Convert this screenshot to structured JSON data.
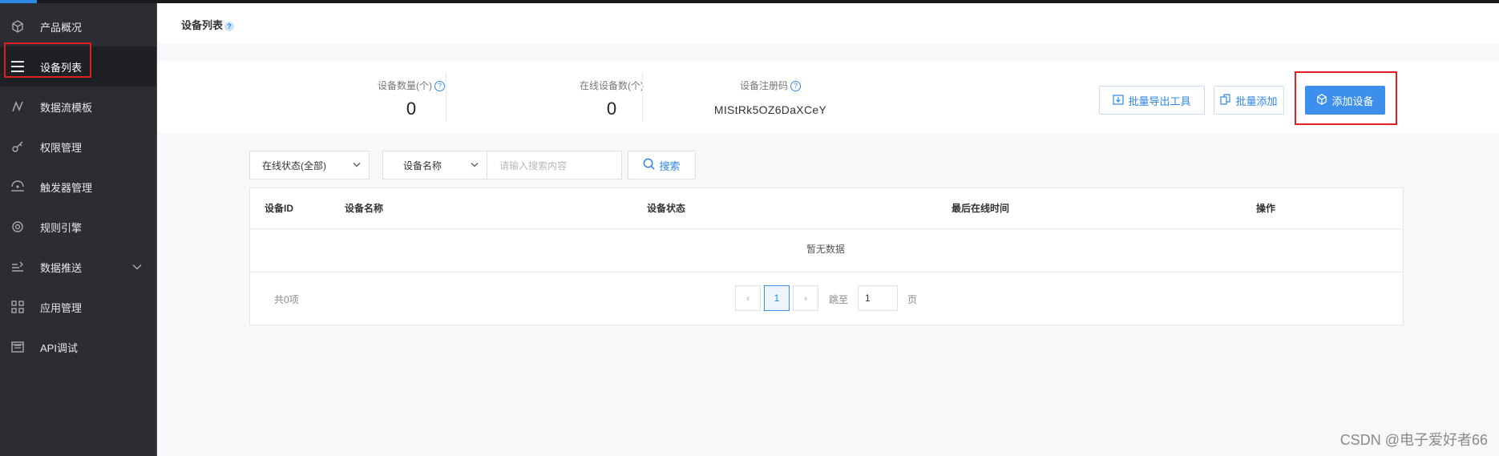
{
  "sidebar": {
    "items": [
      {
        "label": "产品概况",
        "icon": "cube-icon"
      },
      {
        "label": "设备列表",
        "icon": "list-icon",
        "active": true
      },
      {
        "label": "数据流模板",
        "icon": "dataflow-icon"
      },
      {
        "label": "权限管理",
        "icon": "key-icon"
      },
      {
        "label": "触发器管理",
        "icon": "trigger-icon"
      },
      {
        "label": "规则引擎",
        "icon": "rule-icon"
      },
      {
        "label": "数据推送",
        "icon": "push-icon",
        "expandable": true
      },
      {
        "label": "应用管理",
        "icon": "grid-icon"
      },
      {
        "label": "API调试",
        "icon": "api-icon"
      }
    ]
  },
  "header": {
    "title": "设备列表",
    "help": "?"
  },
  "stats": {
    "device_count_label": "设备数量(个)",
    "device_count": "0",
    "online_count_label": "在线设备数(个)",
    "online_count": "0",
    "reg_code_label": "设备注册码",
    "reg_code": "MIStRk5OZ6DaXCeY"
  },
  "actions": {
    "export_tool": "批量导出工具",
    "batch_add": "批量添加",
    "add_device": "添加设备"
  },
  "filters": {
    "status_select": "在线状态(全部)",
    "field_select": "设备名称",
    "search_placeholder": "请输入搜索内容",
    "search_button": "搜索"
  },
  "table": {
    "columns": [
      "设备ID",
      "设备名称",
      "设备状态",
      "最后在线时间",
      "操作"
    ],
    "empty_text": "暂无数据",
    "total": "共0项",
    "current_page": "1",
    "prev": "‹",
    "next": "›",
    "jump_label": "跳至",
    "jump_value": "1",
    "page_unit": "页"
  },
  "watermark": "CSDN @电子爱好者66",
  "colors": {
    "accent": "#3d8fee",
    "sidebar_bg": "#2c2d33",
    "highlight": "#e02020"
  }
}
